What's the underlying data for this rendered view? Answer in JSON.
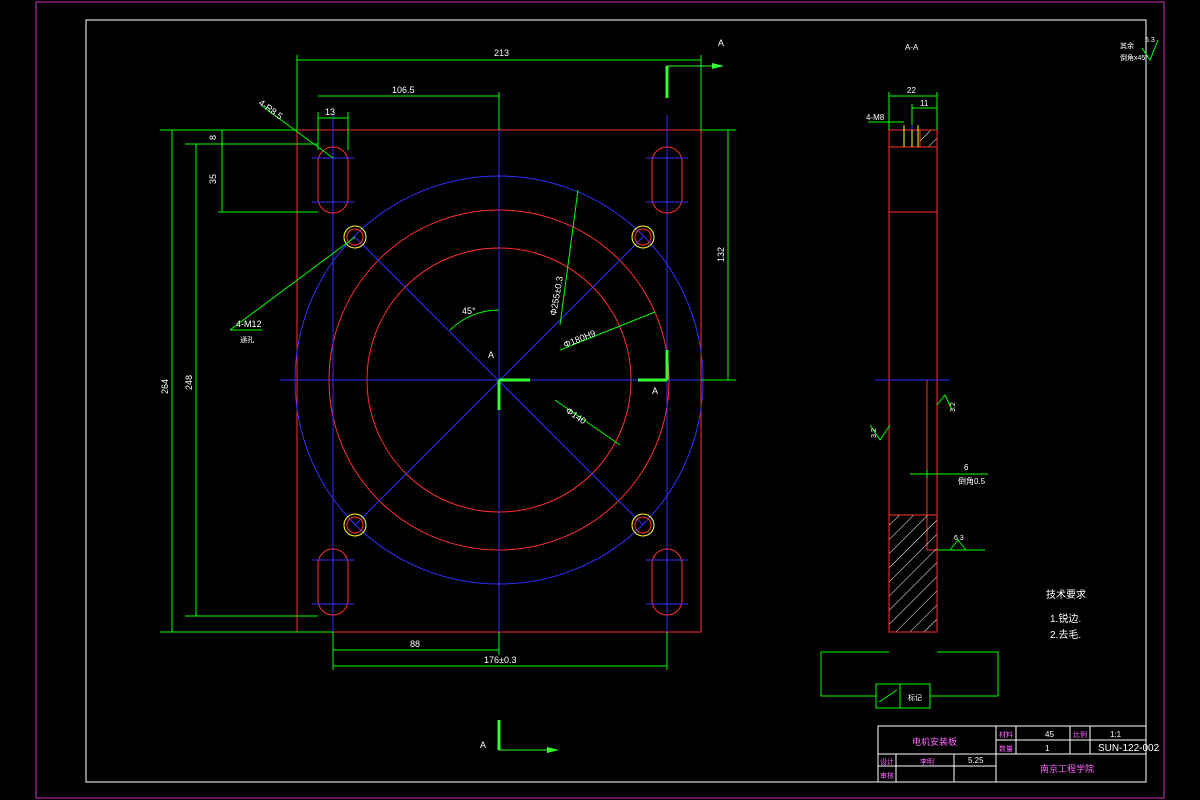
{
  "colors": {
    "background": "#000000",
    "frame": "#cc33cc",
    "plate": "#ff3030",
    "centerline": "#3030ff",
    "dimension": "#00ff00",
    "hole": "#ffff33",
    "text": "#ffffff",
    "section_marker": "#33ff33"
  },
  "icons": {
    "section_arrow": "arrow-right-icon",
    "roughness": "roughness-symbol-icon"
  },
  "dimensions": {
    "d213": "213",
    "d106_5": "106.5",
    "d13": "13",
    "d4r8_5": "4-R8.5",
    "d8": "8",
    "d35": "35",
    "d132": "132",
    "d264": "264",
    "d248": "248",
    "d88": "88",
    "d176": "176±0.3",
    "d4m12_a": "4-M12",
    "d4m12_b": "通孔",
    "d45deg": "45°",
    "phi255": "Φ255±0.3",
    "phi180": "Φ180H9",
    "phi140": "Φ140",
    "d22": "22",
    "d11": "11",
    "d4m8": "4-M8",
    "d6": "6",
    "chamfer": "倒角x45°",
    "chamfer2": "倒角0.5",
    "rough_a": "3.2",
    "rough_b": "3.2",
    "rough_c": "6.3",
    "rough_top": "6.3",
    "rough_top_lbl": "其余"
  },
  "labels": {
    "section_a_top": "A",
    "section_a_left": "A",
    "section_a_right": "A",
    "section_a_bottom": "A",
    "section_aa": "A-A",
    "detail_label": "标记"
  },
  "tech_requirements": {
    "title": "技术要求",
    "items": [
      "1.锐边.",
      "2.去毛."
    ]
  },
  "title_block": {
    "part_name": "电机安装板",
    "material_lbl": "材料",
    "material_val": "45",
    "ratio_lbl": "比例",
    "ratio_val": "1:1",
    "qty_lbl": "数量",
    "qty_val": "1",
    "drawing_no": "SUN-122-002",
    "design_lbl": "设计",
    "review_lbl": "审核",
    "date_val": "5.25",
    "school": "南京工程学院"
  }
}
